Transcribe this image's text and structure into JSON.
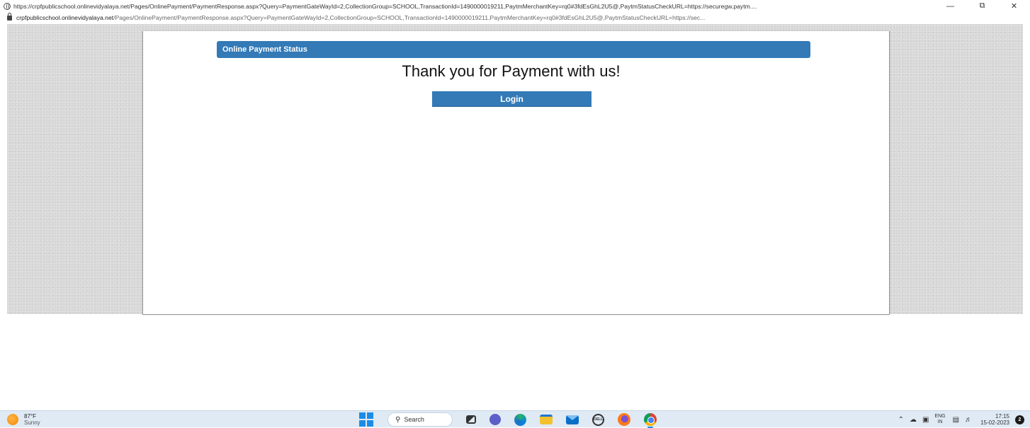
{
  "window": {
    "title_url": "https://crpfpublicschool.onlinevidyalaya.net/Pages/OnlinePayment/PaymentResponse.aspx?Query=PaymentGateWayId=2,CollectionGroup=SCHOOL,TransactionId=1490000019211,PaytmMerchantKey=rq0#3fdEsGhL2U5@,PaytmStatusCheckURL=https://securegw.paytm....",
    "minimize": "—",
    "restore": "⧉",
    "close": "✕"
  },
  "address": {
    "host": "crpfpublicschool.onlinevidyalaya.net",
    "path": "/Pages/OnlinePayment/PaymentResponse.aspx?Query=PaymentGateWayId=2,CollectionGroup=SCHOOL,TransactionId=1490000019211,PaytmMerchantKey=rq0#3fdEsGhL2U5@,PaytmStatusCheckURL=https://sec..."
  },
  "page": {
    "header": "Online Payment Status",
    "message": "Thank you for Payment with us!",
    "login_label": "Login",
    "accent_color": "#337ab7"
  },
  "taskbar": {
    "weather_temp": "87°F",
    "weather_condition": "Sunny",
    "search_label": "Search",
    "dell_label": "DELL",
    "lang_top": "ENG",
    "lang_bottom": "IN",
    "time": "17:15",
    "date": "15-02-2023",
    "notification_count": "2"
  }
}
